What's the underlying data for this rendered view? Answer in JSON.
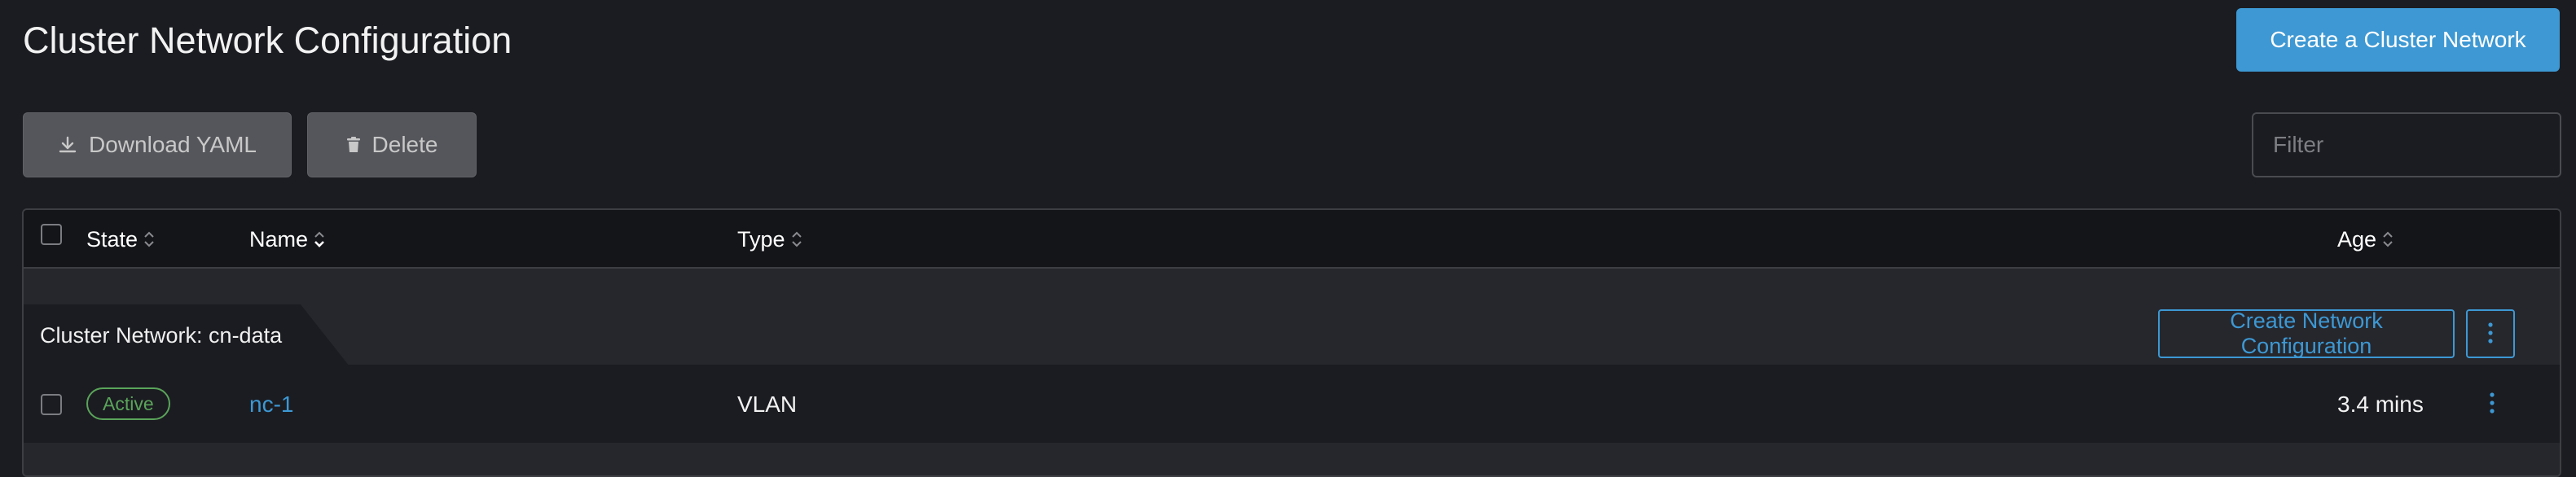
{
  "header": {
    "title": "Cluster Network Configuration",
    "create_button": "Create a Cluster Network"
  },
  "toolbar": {
    "download_label": "Download YAML",
    "download_icon": "download-icon",
    "delete_label": "Delete",
    "delete_icon": "trash-icon",
    "filter_placeholder": "Filter",
    "filter_value": ""
  },
  "table": {
    "columns": [
      {
        "label": "State",
        "sort": "unsorted"
      },
      {
        "label": "Name",
        "sort": "ascending"
      },
      {
        "label": "Type",
        "sort": "unsorted"
      },
      {
        "label": "Age",
        "sort": "unsorted"
      }
    ],
    "groups": [
      {
        "label": "Cluster Network: cn-data",
        "action_label": "Create Network Configuration",
        "rows": [
          {
            "state": "Active",
            "name": "nc-1",
            "type": "VLAN",
            "age": "3.4 mins"
          }
        ]
      }
    ]
  },
  "colors": {
    "accent": "#3d98d3",
    "active": "#5aa45a",
    "background": "#1b1c21"
  }
}
